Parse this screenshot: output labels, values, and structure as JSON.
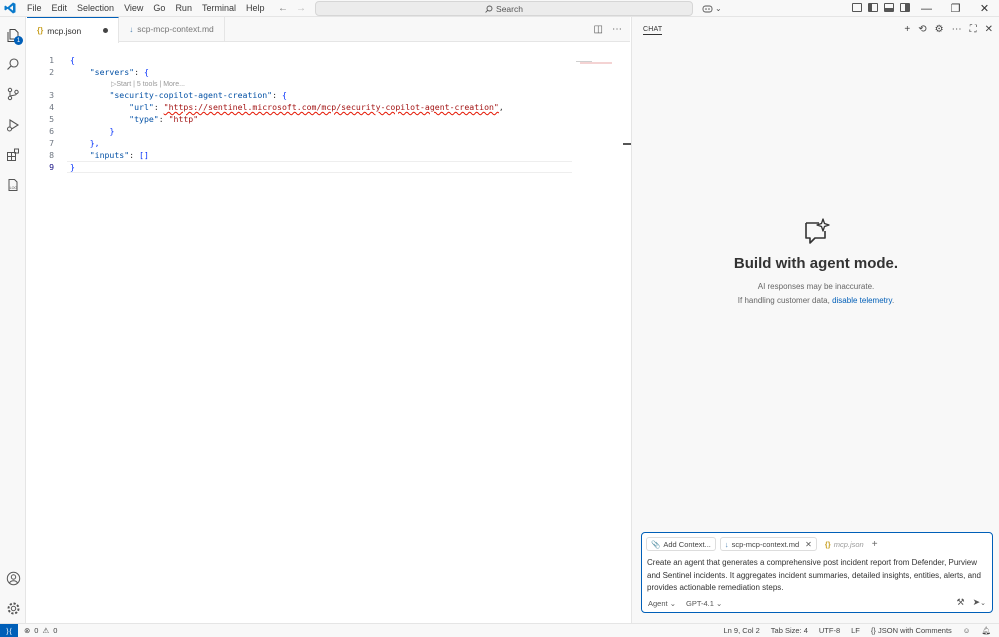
{
  "window": {
    "menu": [
      "File",
      "Edit",
      "Selection",
      "View",
      "Go",
      "Run",
      "Terminal",
      "Help"
    ],
    "search_label": "Search"
  },
  "activity_bar": {
    "explorer_badge": "1"
  },
  "editor": {
    "tabs": [
      {
        "label": "mcp.json",
        "active": true,
        "modified": true
      },
      {
        "label": "scp-mcp-context.md",
        "active": false,
        "modified": false
      }
    ],
    "codelens": "▷Start | 5 tools | More...",
    "lines": [
      {
        "num": "1",
        "parts": [
          {
            "t": "{",
            "c": "p"
          }
        ]
      },
      {
        "num": "2",
        "parts": [
          {
            "t": "    ",
            "c": ""
          },
          {
            "t": "\"servers\"",
            "c": "k"
          },
          {
            "t": ": ",
            "c": ""
          },
          {
            "t": "{",
            "c": "p"
          }
        ]
      },
      {
        "num": "3",
        "parts": [
          {
            "t": "        ",
            "c": ""
          },
          {
            "t": "\"security-copilot-agent-creation\"",
            "c": "k"
          },
          {
            "t": ": ",
            "c": ""
          },
          {
            "t": "{",
            "c": "p"
          }
        ]
      },
      {
        "num": "4",
        "parts": [
          {
            "t": "            ",
            "c": ""
          },
          {
            "t": "\"url\"",
            "c": "k"
          },
          {
            "t": ": ",
            "c": ""
          },
          {
            "t": "\"https://sentinel.microsoft.com/mcp/security-copilot-agent-creation\"",
            "c": "s u"
          },
          {
            "t": ",",
            "c": ""
          }
        ]
      },
      {
        "num": "5",
        "parts": [
          {
            "t": "            ",
            "c": ""
          },
          {
            "t": "\"type\"",
            "c": "k"
          },
          {
            "t": ": ",
            "c": ""
          },
          {
            "t": "\"http\"",
            "c": "s"
          }
        ]
      },
      {
        "num": "6",
        "parts": [
          {
            "t": "        ",
            "c": ""
          },
          {
            "t": "}",
            "c": "p"
          }
        ]
      },
      {
        "num": "7",
        "parts": [
          {
            "t": "    ",
            "c": ""
          },
          {
            "t": "},",
            "c": "p"
          }
        ]
      },
      {
        "num": "8",
        "parts": [
          {
            "t": "    ",
            "c": ""
          },
          {
            "t": "\"inputs\"",
            "c": "k"
          },
          {
            "t": ": ",
            "c": ""
          },
          {
            "t": "[]",
            "c": "p"
          }
        ]
      },
      {
        "num": "9",
        "parts": [
          {
            "t": "}",
            "c": "p"
          }
        ]
      }
    ]
  },
  "chat": {
    "title": "CHAT",
    "heading": "Build with agent mode.",
    "disclaimer": "AI responses may be inaccurate.",
    "telemetry_prefix": "If handling customer data, ",
    "telemetry_link": "disable telemetry",
    "telemetry_suffix": ".",
    "chips": {
      "add_context": "Add Context...",
      "file1": "scp-mcp-context.md",
      "file2": "mcp.json"
    },
    "input_text": "Create an agent that generates a comprehensive post incident report from Defender, Purview and Sentinel incidents. It aggregates incident summaries, detailed insights, entities, alerts, and provides actionable remediation steps.",
    "mode": "Agent",
    "model": "GPT-4.1"
  },
  "statusbar": {
    "errors": "0",
    "warnings": "0",
    "position": "Ln 9, Col 2",
    "tab_size": "Tab Size: 4",
    "encoding": "UTF-8",
    "eol": "LF",
    "language": "JSON with Comments"
  },
  "colors": {
    "accent": "#005fb8",
    "key": "#0451a5",
    "string": "#a31515"
  }
}
